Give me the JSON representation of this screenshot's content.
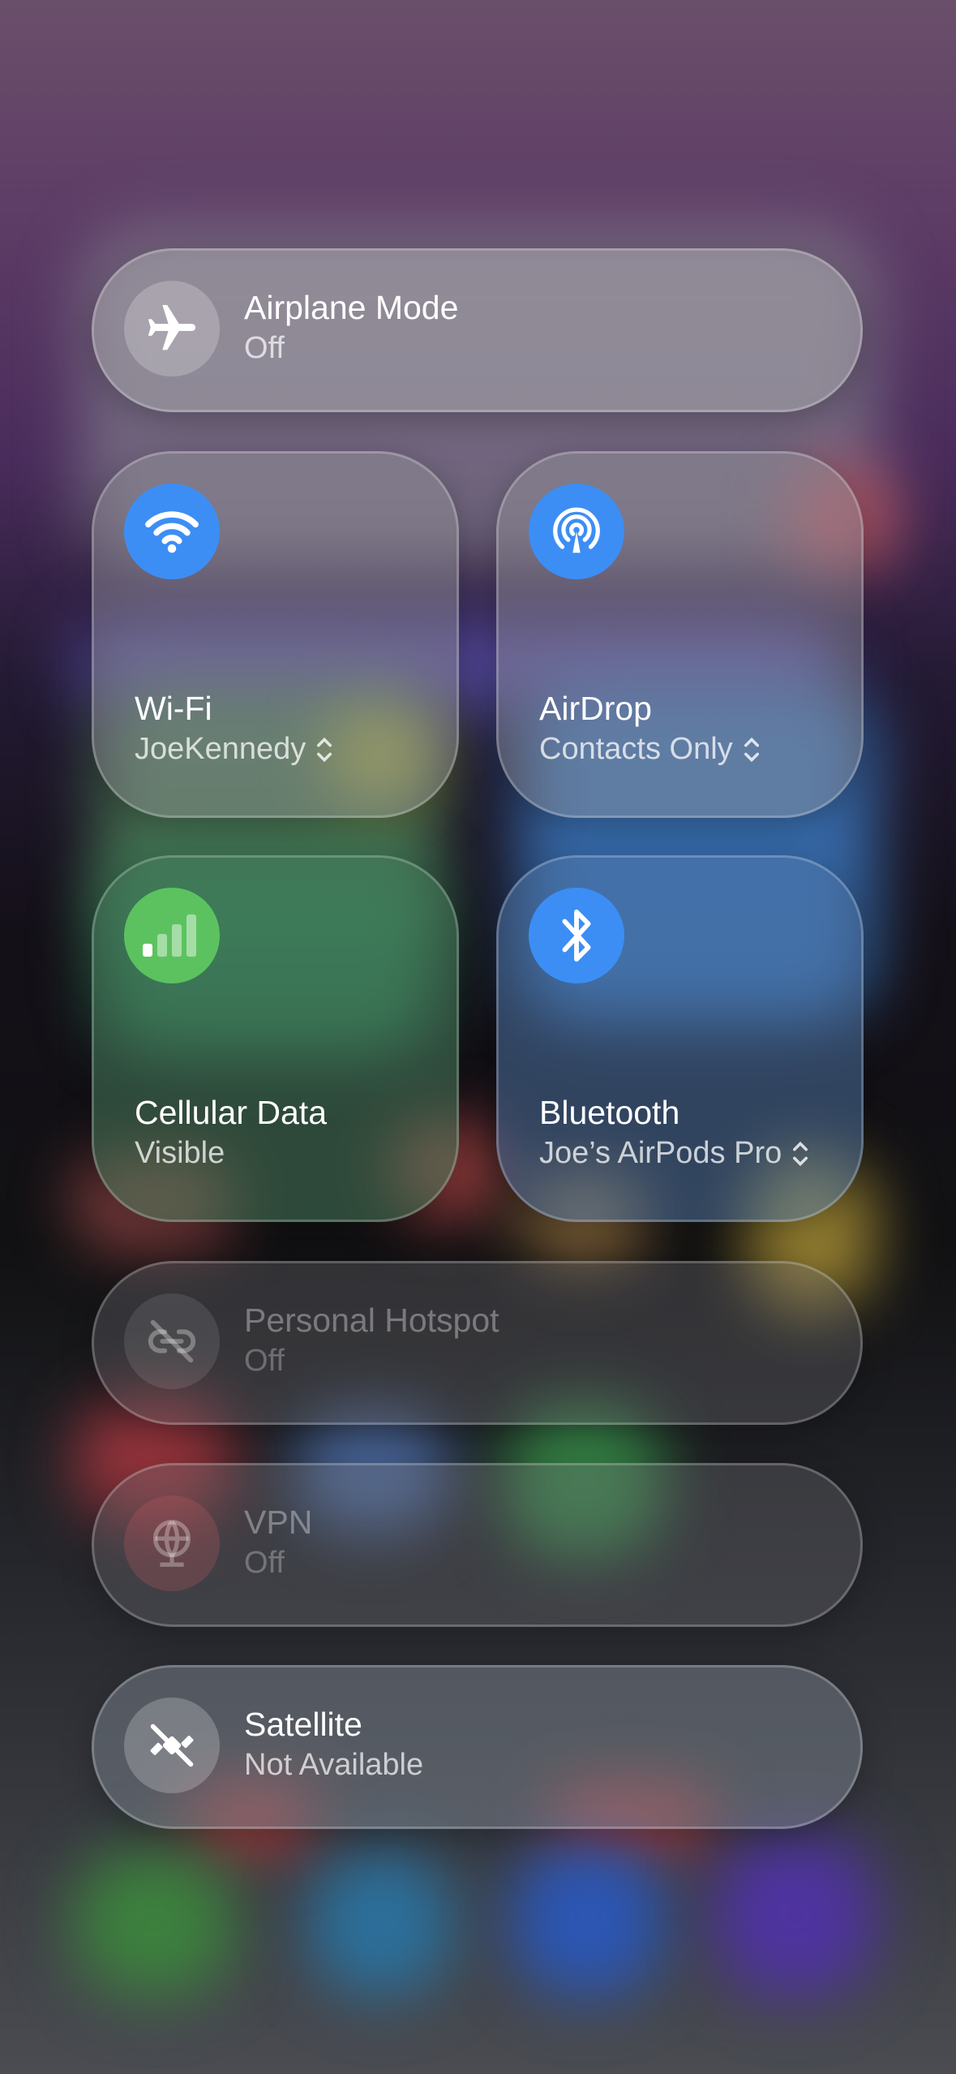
{
  "airplane": {
    "title": "Airplane Mode",
    "status": "Off",
    "icon": "airplane-icon"
  },
  "wifi": {
    "title": "Wi-Fi",
    "network": "JoeKennedy",
    "icon": "wifi-icon",
    "color": "#3c8ef5"
  },
  "airdrop": {
    "title": "AirDrop",
    "status": "Contacts Only",
    "icon": "airdrop-icon",
    "color": "#3c8ef5"
  },
  "cellular": {
    "title": "Cellular Data",
    "status": "Visible",
    "icon": "cellular-bars-icon",
    "color": "#5cc25f"
  },
  "bluetooth": {
    "title": "Bluetooth",
    "device": "Joe’s AirPods Pro",
    "icon": "bluetooth-icon",
    "color": "#3c8ef5"
  },
  "hotspot": {
    "title": "Personal Hotspot",
    "status": "Off",
    "icon": "hotspot-link-icon"
  },
  "vpn": {
    "title": "VPN",
    "status": "Off",
    "icon": "vpn-globe-icon"
  },
  "satellite": {
    "title": "Satellite",
    "status": "Not Available",
    "icon": "satellite-off-icon"
  }
}
